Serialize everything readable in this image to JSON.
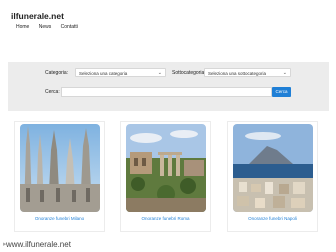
{
  "site": {
    "logo": "ilfunerale.net"
  },
  "nav": {
    "items": [
      "Home",
      "News",
      "Contatti"
    ]
  },
  "search": {
    "category_label": "Categoria:",
    "category_value": "Seleziona una categoria",
    "subcategory_label": "Sottocategoria:",
    "subcategory_value": "Seleziona una sottocategoria",
    "search_label": "Cerca:",
    "search_placeholder": "",
    "button_label": "Cerca"
  },
  "cards": [
    {
      "caption": "Onoranze funebri Milano",
      "image": "milan-cathedral-spires"
    },
    {
      "caption": "Onoranze funebri Roma",
      "image": "rome-ruins"
    },
    {
      "caption": "Onoranze funebri Napoli",
      "image": "naples-bay-vesuvius"
    }
  ],
  "footer": {
    "text": "www.ilfunerale.net"
  }
}
